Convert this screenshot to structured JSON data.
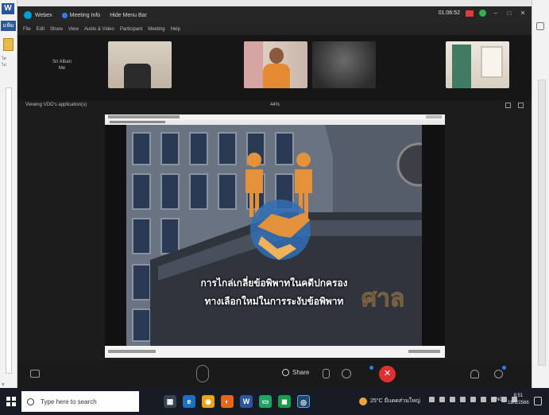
{
  "underlying_app": {
    "word_tile": "W",
    "file_tab": "แฟ้ม",
    "small_labels": [
      "ไต",
      "ไป",
      "ช่"
    ]
  },
  "titlebar": {
    "app_name": "Webex",
    "meeting_info": "Meeting Info",
    "hide_menu": "Hide Menu Bar",
    "timer": "01:06:52"
  },
  "menubar": {
    "items": [
      "File",
      "Edit",
      "Share",
      "View",
      "Audio & Video",
      "Participant",
      "Meeting",
      "Help"
    ]
  },
  "participants": {
    "name_label": "Sri Alban",
    "name_sub": "Me"
  },
  "viewbar": {
    "viewing": "Viewing VDO's application(s)",
    "zoom": "44%"
  },
  "slide": {
    "line1": "การไกล่เกลี่ยข้อพิพาทในคดีปกครอง",
    "line2": "ทางเลือกใหม่ในการระงับข้อพิพาท",
    "building_sign": "ศาล"
  },
  "controls": {
    "share_label": "Share",
    "end_icon": "✕"
  },
  "taskbar": {
    "search_placeholder": "Type here to search",
    "weather": "25°C มีแดดส่วนใหญ่",
    "lang": "ENG",
    "time": "8:51",
    "date": "18/1/2566"
  },
  "colors": {
    "end_call": "#e02f2f",
    "webex_bg": "#1c1c1c",
    "taskbar_bg": "#161b24",
    "accent_blue": "#2f80ed"
  }
}
